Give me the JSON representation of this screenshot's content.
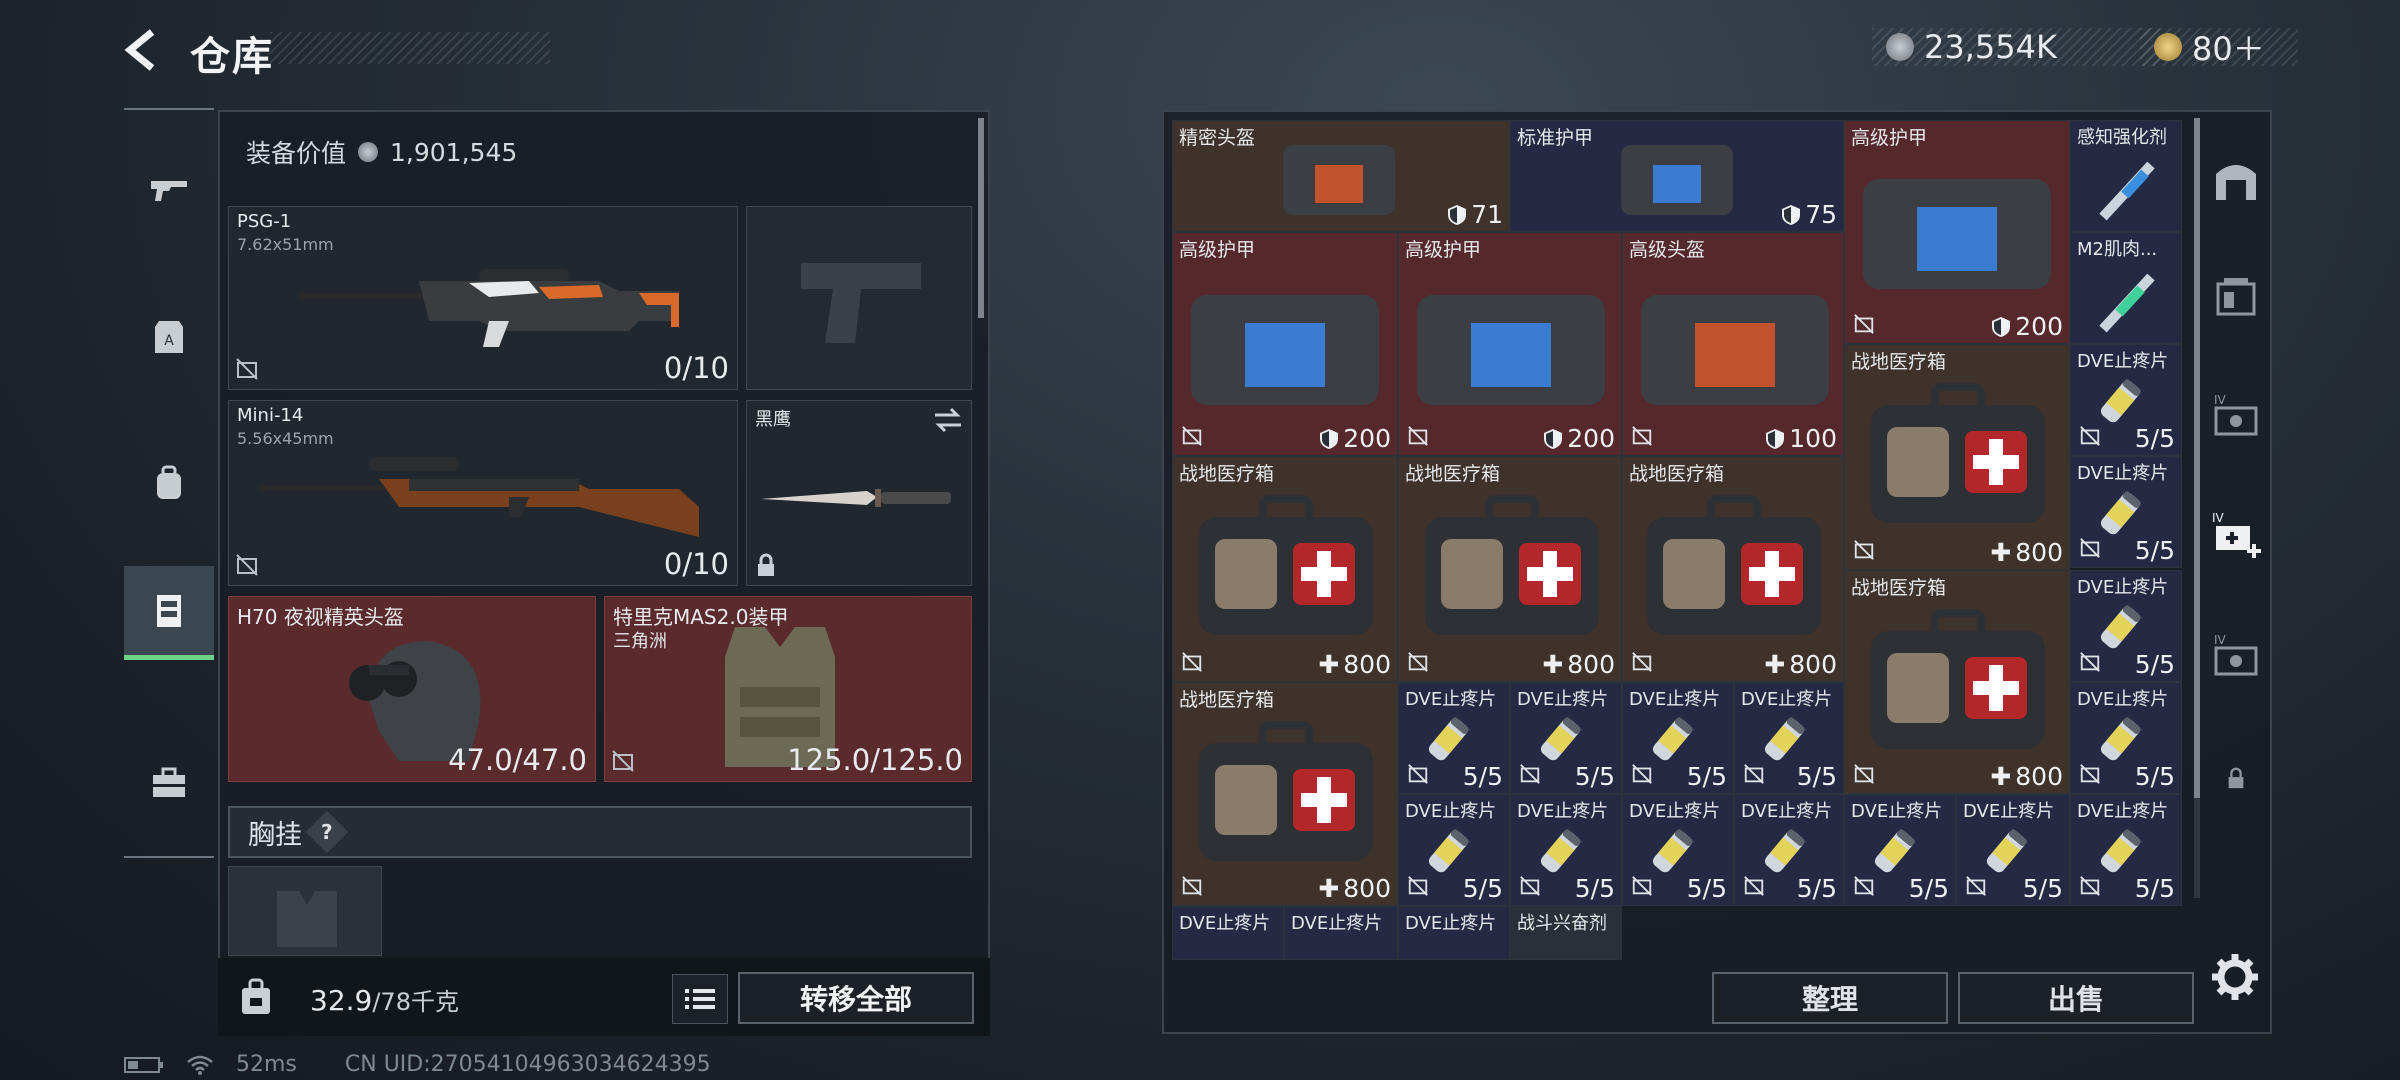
{
  "header": {
    "title": "仓库",
    "currency_1": "23,554K",
    "currency_2": "80＋"
  },
  "sidebar": [
    "gun-icon",
    "armor-icon",
    "backpack-icon",
    "chest-rig-icon",
    "toolbox-icon"
  ],
  "equip": {
    "value_label": "装备价值",
    "value": "1,901,545",
    "primary": {
      "name": "PSG-1",
      "caliber": "7.62x51mm",
      "ammo": "0/10"
    },
    "secondary": {
      "name": "Mini-14",
      "caliber": "5.56x45mm",
      "ammo": "0/10"
    },
    "melee": {
      "name": "黑鹰"
    },
    "helmet": {
      "name": "H70 夜视精英头盔",
      "durability": "47.0/47.0"
    },
    "armor": {
      "name": "特里克MAS2.0装甲",
      "sub": "三角洲",
      "durability": "125.0/125.0"
    },
    "chest_rig": "胸挂",
    "chest_rig_help": "?"
  },
  "bottom": {
    "weight": "32.9",
    "weight_max": "/78千克",
    "transfer_all": "转移全部",
    "sort": "整理",
    "sell": "出售"
  },
  "status": {
    "ping": "52ms",
    "uid": "CN UID:2705410496303462439​5"
  },
  "inventory": {
    "precise_helmet": {
      "name": "精密头盔",
      "val": "71"
    },
    "standard_armor": {
      "name": "标准护甲",
      "val": "75"
    },
    "advanced_armor_big": {
      "name": "高级护甲",
      "val": "200"
    },
    "perception": {
      "name": "感知强化剂"
    },
    "m2": {
      "name": "M2肌肉..."
    },
    "armor_a": {
      "name": "高级护甲",
      "val": "200"
    },
    "armor_b": {
      "name": "高级护甲",
      "val": "200"
    },
    "helmet_c": {
      "name": "高级头盔",
      "val": "100"
    },
    "medkit_label": "战地医疗箱",
    "medkit_val": "800",
    "dve_label": "DVE止疼片",
    "dve_val": "5/5",
    "stim_label": "战斗兴奋剂"
  },
  "colors": {
    "accent_green": "#6fd28a",
    "cell_red": "#55282b",
    "cell_blue": "#252a44",
    "cell_brown": "#3e322b"
  }
}
